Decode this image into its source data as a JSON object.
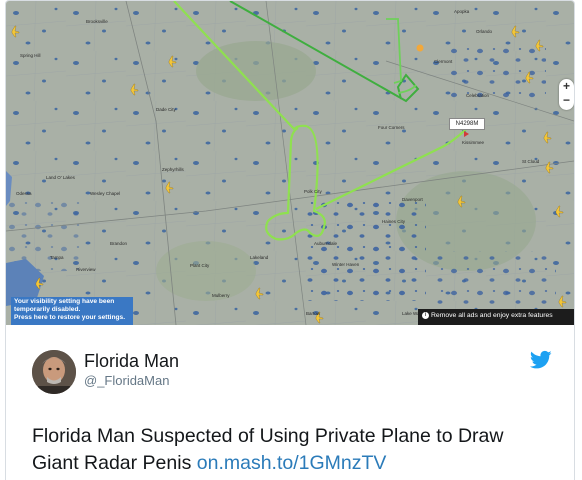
{
  "map": {
    "notice": {
      "line1": "Your visibility setting have been",
      "line2": "temporarily disabled.",
      "line3": "Press here to restore your settings."
    },
    "ad_bar_text": "Remove all ads and enjoy extra features",
    "flight_tag": "N4298M",
    "zoom_in": "+",
    "zoom_out": "−",
    "city_labels": [
      "Spring Hill",
      "Brooksville",
      "Dade City",
      "Zephyrhills",
      "Lakeland",
      "Plant City",
      "Orlando",
      "Kissimmee",
      "Winter Haven",
      "Haines City",
      "Bartow",
      "Wesley Chapel",
      "Land O' Lakes",
      "Tampa",
      "Odessa",
      "Clermont",
      "Davenport",
      "Mulberry",
      "Polk City",
      "Auburndale",
      "St Cloud",
      "Apopka",
      "Four Corners",
      "Lake Wales",
      "Celebration",
      "Riverview",
      "Brandon"
    ]
  },
  "tweet": {
    "author_name": "Florida Man",
    "author_handle": "@_FloridaMan",
    "text": "Florida Man Suspected of Using Private Plane to Draw Giant Radar Penis ",
    "link": "on.mash.to/1GMnzTV"
  },
  "colors": {
    "flight_path_green": "#7fd64a",
    "flight_path_dark": "#3a9a3a",
    "twitter_blue": "#1da1f2",
    "link_blue": "#2b7bb9"
  }
}
